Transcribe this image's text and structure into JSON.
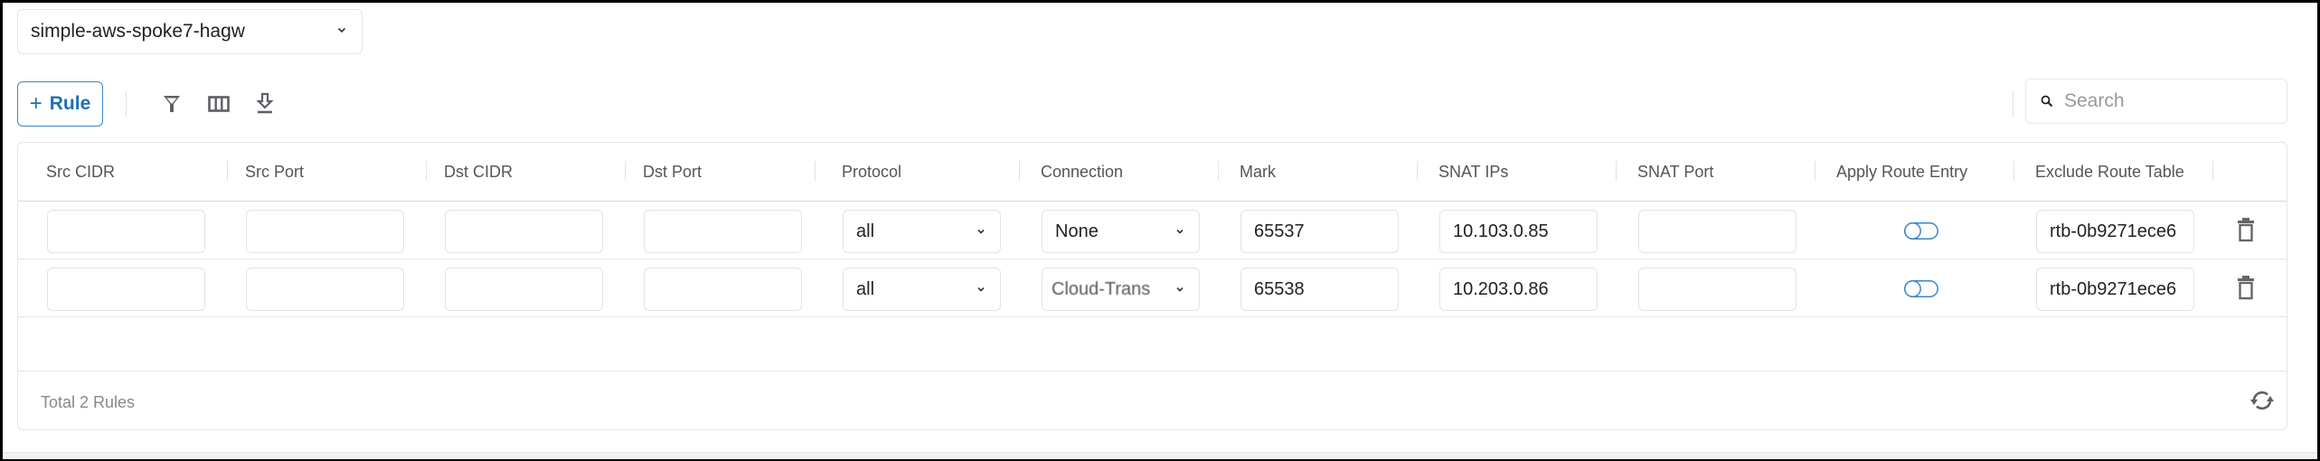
{
  "gateway_selector": {
    "value": "simple-aws-spoke7-hagw"
  },
  "toolbar": {
    "add_rule_label": "Rule",
    "add_rule_icon": "plus-icon",
    "icons": [
      "filter-icon",
      "columns-icon",
      "download-icon"
    ],
    "search_placeholder": "Search",
    "search_value": ""
  },
  "table": {
    "columns": [
      "Src CIDR",
      "Src Port",
      "Dst CIDR",
      "Dst Port",
      "Protocol",
      "Connection",
      "Mark",
      "SNAT IPs",
      "SNAT Port",
      "Apply Route Entry",
      "Exclude Route Table"
    ],
    "rows": [
      {
        "src_cidr": "",
        "src_port": "",
        "dst_cidr": "",
        "dst_port": "",
        "protocol": "all",
        "connection": "None",
        "mark": "65537",
        "snat_ips": "10.103.0.85",
        "snat_port": "",
        "apply_route_entry": false,
        "exclude_route_table": "rtb-0b9271ece6"
      },
      {
        "src_cidr": "",
        "src_port": "",
        "dst_cidr": "",
        "dst_port": "",
        "protocol": "all",
        "connection": "Cloud-Trans",
        "mark": "65538",
        "snat_ips": "10.203.0.86",
        "snat_port": "",
        "apply_route_entry": false,
        "exclude_route_table": "rtb-0b9271ece6"
      }
    ]
  },
  "footer": {
    "total_label": "Total 2 Rules"
  },
  "colors": {
    "accent": "#1f6fb5",
    "toggle_border": "#3b86c7",
    "icon_gray": "#5f5f66"
  }
}
